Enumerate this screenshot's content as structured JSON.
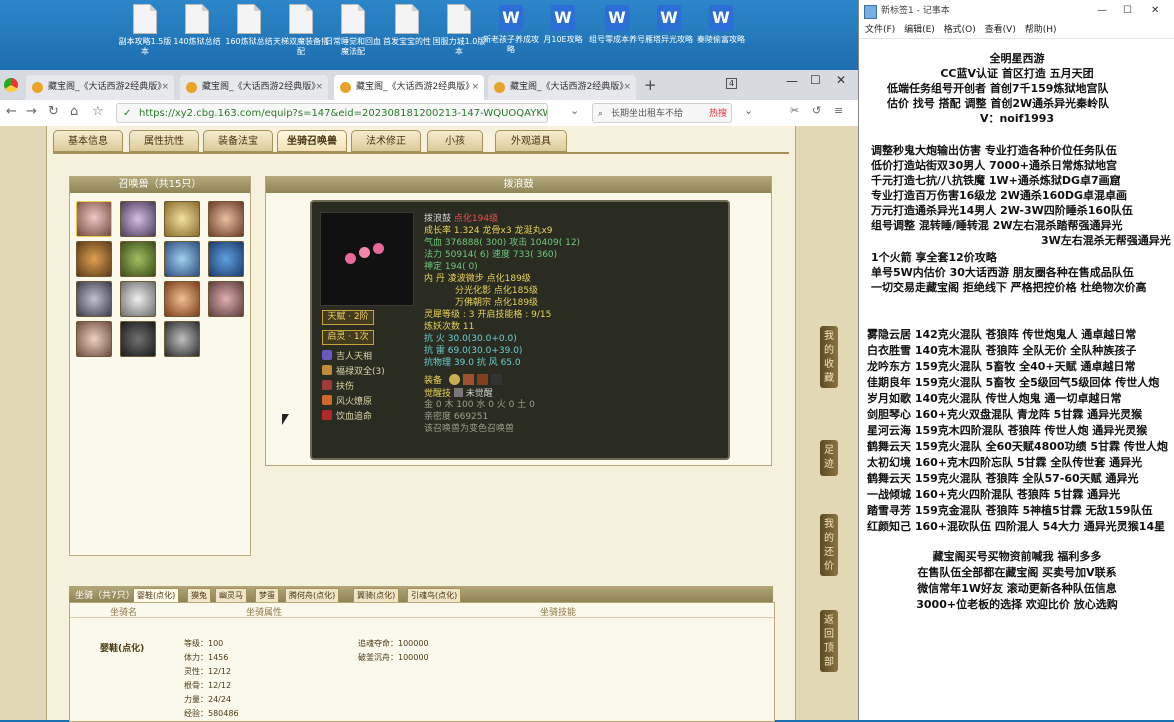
{
  "desktop": {
    "icons": [
      {
        "label": "副本攻略1.5版本",
        "type": "file"
      },
      {
        "label": "140炼狱总结",
        "type": "file"
      },
      {
        "label": "160炼狱总结",
        "type": "file"
      },
      {
        "label": "天梯双魔装备搭配",
        "type": "file"
      },
      {
        "label": "日常睡觉和回血魔法配",
        "type": "file"
      },
      {
        "label": "首发宝宝的性",
        "type": "file"
      },
      {
        "label": "国服力城1.0版本",
        "type": "file"
      },
      {
        "label": "新老孩子养成攻略",
        "type": "word"
      },
      {
        "label": "月10E攻略",
        "type": "word"
      },
      {
        "label": "组号零成本养号",
        "type": "word"
      },
      {
        "label": "雁塔异光攻略",
        "type": "word"
      },
      {
        "label": "秦陵偷富攻略",
        "type": "word"
      }
    ]
  },
  "browser": {
    "tabs": [
      {
        "label": "藏宝阁_《大话西游2经典版》"
      },
      {
        "label": "藏宝阁_《大话西游2经典版》"
      },
      {
        "label": "藏宝阁_《大话西游2经典版》"
      },
      {
        "label": "藏宝阁_《大话西游2经典版》"
      }
    ],
    "tab_count": "4",
    "url": "https://xy2.cbg.163.com/equip?s=147&eid=202308181200213-147-WQUOQAYKWIDH",
    "search_text": "长期坐出租车不给",
    "hot_label": "热搜"
  },
  "page": {
    "tabs": [
      "基本信息",
      "属性抗性",
      "装备法宝",
      "坐骑召唤兽",
      "法术修正",
      "小孩",
      "外观道具"
    ],
    "pet_list_title": "召唤兽（共15只）",
    "detail_title": "拨浪鼓",
    "pet": {
      "name": "拨浪鼓",
      "point": "点化194级",
      "growth": "成长率 1.324",
      "bone": "龙骨x3",
      "pill": "龙涎丸x9",
      "hp_label": "气血",
      "hp": "376888",
      "hp_add": "( 300)",
      "atk_label": "攻击",
      "atk": "10409",
      "atk_add": "( 12)",
      "mp_label": "法力",
      "mp": "50914",
      "mp_add": "( 6)",
      "spd_label": "速度",
      "spd": "733",
      "spd_add": "( 360)",
      "god_label": "神定",
      "god": "194",
      "god_add": "( 0)",
      "inner_label": "内 丹",
      "inner1": "凌波微步 点化189级",
      "inner2": "分光化影 点化185级",
      "inner3": "万佛朝宗 点化189级",
      "soul": "灵犀等级 : 3",
      "soul_skill": "开启技能格 : 9/15",
      "refine": "炼妖次数 11",
      "res1_label": "抗 火",
      "res1": "30.0(30.0+0.0)",
      "res2_label": "抗 雷",
      "res2": "69.0(30.0+39.0)",
      "res3_label": "抗物理",
      "res3": "39.0",
      "res4_label": "抗 风",
      "res4": "65.0",
      "equip_label": "装备",
      "awaken_label": "觉醒技",
      "awaken": "未觉醒",
      "elements": "金 0 木 100 水 0 火 0 土 0",
      "intimacy": "亲密度 669251",
      "note": "该召唤兽为变色召唤兽",
      "talent": "天赋 · 2阶",
      "spirit": "启灵 · 1次",
      "skills": [
        "吉人天相",
        "福禄双全(3)",
        "扶伤",
        "风火燎原",
        "饮血追命"
      ]
    },
    "mount": {
      "bar_label": "坐骑（共7只）",
      "tabs": [
        "婴鞋(点化)",
        "獏兔",
        "幽灵马",
        "梦蛋",
        "腾何舟(点化)",
        "翼骑(点化)",
        "引魂鸟(点化)"
      ],
      "col1": "坐骑名",
      "col2": "坐骑属性",
      "col3": "坐骑技能",
      "name": "婴鞋(点化)",
      "stats": [
        "等级：100",
        "体力：1456",
        "灵性：12/12",
        "根骨：12/12",
        "力量：24/24",
        "经验：580486"
      ],
      "extra": [
        "追魂夺命：100000",
        "破釜沉舟：100000"
      ]
    },
    "side_buttons": [
      "我的收藏",
      "足迹",
      "我的还价",
      "返回顶部"
    ]
  },
  "notepad": {
    "title": "新标签1 - 记事本",
    "menu": [
      "文件(F)",
      "编辑(E)",
      "格式(O)",
      "查看(V)",
      "帮助(H)"
    ],
    "lines": [
      "全明星西游",
      "CC蓝V认证  首区打造  五月天团",
      "低端任务组号开创者          首创7千159炼狱地宫队",
      "估价 找号 搭配 调整         首创2W通杀异光秦岭队",
      "V：noif1993",
      "调整秒鬼大炮输出仿害          专业打造各种价位任务队伍",
      "低价打造站街双30男人          7000+通杀日常炼狱地宫",
      "千元打造七抗/八抗铁魔          1W+通杀炼狱DG卓7画窟",
      "专业打造百万伤害16级龙          2W通杀160DG卓混卓画",
      "万元打造通杀异光14男人        2W-3W四阶睡杀160队伍",
      "组号调整 混转睡/睡转混          2W左右混杀踏帮强通异光",
      "3W左右混杀无帮强通异光",
      "1个火箭 享全套12价攻略",
      "单号5W内估价 30大话西游        朋友圈各种在售成品队伍",
      "一切交易走藏宝阁 拒绝线下    严格把控价格 杜绝物次价高",
      "雾隐云居 142克火混队 苍狼阵 传世炮鬼人 通卓越日常",
      "白衣胜雪 140克木混队 苍狼阵 全队无价 全队种族孩子",
      "龙吟东方 159克火混队 5畜牧 全40+天赋 通卓越日常",
      "佳期良年 159克火混队 5畜牧 全5级回气5级回体 传世人炮",
      "岁月如歌 140克火混队 传世人炮鬼 通一切卓越日常",
      "剑胆琴心 160+克火双盘混队 青龙阵 5甘霖 通异光灵猴",
      "星河云海 159克木四阶混队 苍狼阵 传世人炮 通异光灵猴",
      "鹤舞云天 159克火混队 全60天赋4800功绩 5甘霖 传世人炮",
      "太初幻境 160+克木四阶忘队 5甘霖 全队传世套 通异光",
      "鹤舞云天 159克火混队 苍狼阵 全队57-60天赋 通异光",
      "一战倾城 160+克火四阶混队 苍狼阵 5甘霖 通异光",
      "踏雪寻芳 159克金混队 苍狼阵 5神植5甘霖 无敌159队伍",
      "红颜知己 160+混砍队伍 四阶混人 54大力 通异光灵猴14星",
      "藏宝阁买号买物资前喊我 福利多多",
      "在售队伍全部都在藏宝阁 买卖号加V联系",
      "微信常年1W好友 滚动更新各种队伍信息",
      "3000+位老板的选择 欢迎比价 放心选购"
    ]
  }
}
